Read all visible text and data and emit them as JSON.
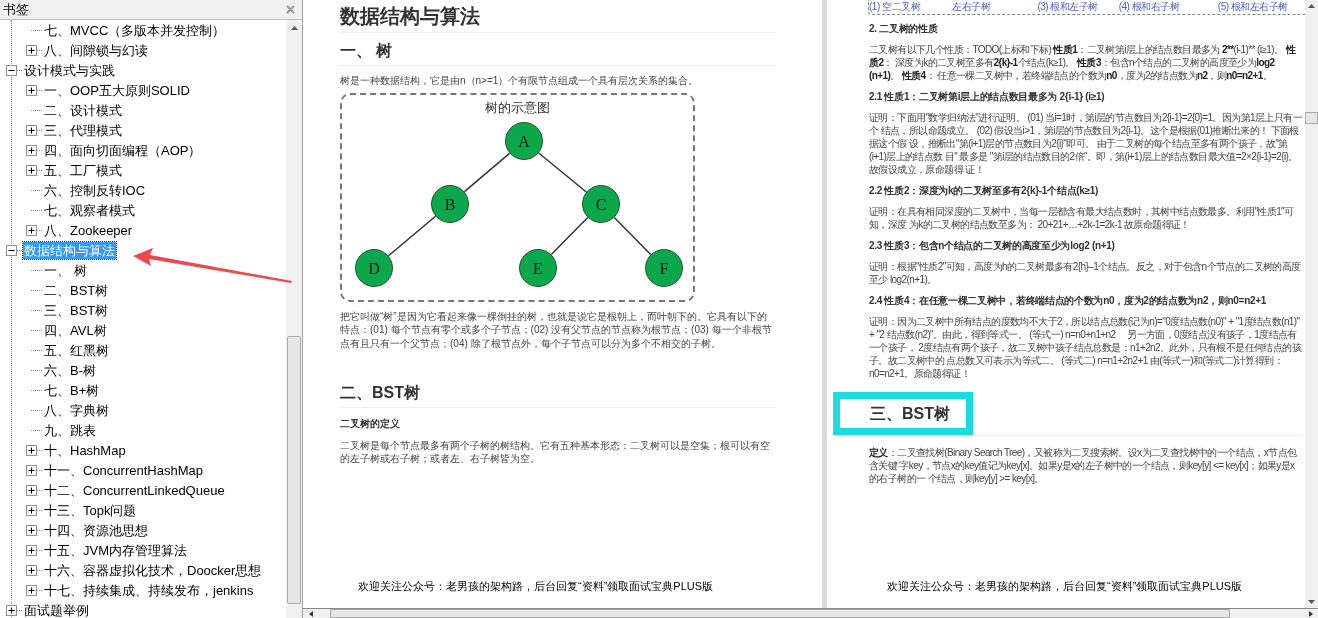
{
  "bookmarks_panel": {
    "title": "书签",
    "items": [
      {
        "kind": "continuation",
        "children": [
          {
            "kind": "leaf",
            "label": "七、MVCC（多版本并发控制）",
            "selected": false
          },
          {
            "kind": "branch",
            "label": "八、间隙锁与幻读",
            "expanded": false,
            "selected": false
          }
        ]
      },
      {
        "kind": "branch",
        "label": "设计模式与实践",
        "expanded": true,
        "selected": false,
        "children": [
          {
            "kind": "branch",
            "label": "一、OOP五大原则SOLID",
            "expanded": false,
            "selected": false
          },
          {
            "kind": "leaf",
            "label": "二、设计模式",
            "selected": false
          },
          {
            "kind": "branch",
            "label": "三、代理模式",
            "expanded": false,
            "selected": false
          },
          {
            "kind": "branch",
            "label": "四、面向切面编程（AOP）",
            "expanded": false,
            "selected": false
          },
          {
            "kind": "branch",
            "label": "五、工厂模式",
            "expanded": false,
            "selected": false
          },
          {
            "kind": "leaf",
            "label": "六、控制反转IOC",
            "selected": false
          },
          {
            "kind": "leaf",
            "label": "七、观察者模式",
            "selected": false
          },
          {
            "kind": "branch",
            "label": "八、Zookeeper",
            "expanded": false,
            "selected": false
          }
        ]
      },
      {
        "kind": "branch",
        "label": "数据结构与算法",
        "expanded": true,
        "selected": true,
        "children": [
          {
            "kind": "leaf",
            "label": "一、 树",
            "selected": false
          },
          {
            "kind": "leaf",
            "label": "二、BST树",
            "selected": false
          },
          {
            "kind": "leaf",
            "label": "三、BST树",
            "selected": false
          },
          {
            "kind": "leaf",
            "label": "四、AVL树",
            "selected": false
          },
          {
            "kind": "leaf",
            "label": "五、红黑树",
            "selected": false
          },
          {
            "kind": "leaf",
            "label": "六、B-树",
            "selected": false
          },
          {
            "kind": "leaf",
            "label": "七、B+树",
            "selected": false
          },
          {
            "kind": "leaf",
            "label": "八、字典树",
            "selected": false
          },
          {
            "kind": "leaf",
            "label": "九、跳表",
            "selected": false
          },
          {
            "kind": "branch",
            "label": "十、HashMap",
            "expanded": false,
            "selected": false
          },
          {
            "kind": "branch",
            "label": "十一、ConcurrentHashMap",
            "expanded": false,
            "selected": false
          },
          {
            "kind": "branch",
            "label": "十二、ConcurrentLinkedQueue",
            "expanded": false,
            "selected": false
          },
          {
            "kind": "branch",
            "label": "十三、Topk问题",
            "expanded": false,
            "selected": false
          },
          {
            "kind": "branch",
            "label": "十四、资源池思想",
            "expanded": false,
            "selected": false
          },
          {
            "kind": "branch",
            "label": "十五、JVM内存管理算法",
            "expanded": false,
            "selected": false
          },
          {
            "kind": "branch",
            "label": "十六、容器虚拟化技术，Doocker思想",
            "expanded": false,
            "selected": false
          },
          {
            "kind": "branch",
            "label": "十七、持续集成、持续发布，jenkins",
            "expanded": false,
            "selected": false
          }
        ]
      },
      {
        "kind": "branch",
        "label": "面试题举例",
        "expanded": false,
        "selected": false
      }
    ]
  },
  "page_1": {
    "title": "数据结构与算法",
    "section_1": {
      "heading": "一、 树",
      "intro": "树是一种数据结构，它是由n（n>=1）个有限节点组成一个具有层次关系的集合。",
      "figure": {
        "title": "树的示意图",
        "root": {
          "label": "A",
          "children": [
            {
              "label": "B",
              "children": [
                {
                  "label": "D"
                }
              ]
            },
            {
              "label": "C",
              "children": [
                {
                  "label": "E"
                },
                {
                  "label": "F"
                }
              ]
            }
          ]
        }
      },
      "body": "把它叫做“树”是因为它看起来像一棵倒挂的树，也就是说它是根朝上，而叶朝下的。它具有以下的特点：(01) 每个节点有零个或多个子节点；(02) 没有父节点的节点称为根节点；(03) 每一个非根节点有且只有一个父节点；(04) 除了根节点外，每个子节点可以分为多个不相交的子树。"
    },
    "section_2": {
      "heading": "二、BST树",
      "subheading": "二叉树的定义",
      "body": "二叉树是每个节点最多有两个子树的树结构。它有五种基本形态：二叉树可以是空集；根可以有空的左子树或右子树；或者左、右子树皆为空。"
    },
    "footer": "欢迎关注公众号：老男孩的架构路，后台回复“资料”领取面试宝典PLUS版"
  },
  "page_2": {
    "figure_captions": [
      "(1) 空二叉树",
      "左右子树",
      "(3) 根和左子树",
      "(4) 根和右子树",
      "(5) 根和左右子树"
    ],
    "blocks": [
      {
        "kind": "heading",
        "text": "2. 二叉树的性质"
      },
      {
        "kind": "paragraph",
        "lines": [
          [
            {
              "text": "二叉树有以下几个性质：TODO(上标和下标) ",
              "bold": false
            },
            {
              "text": "性质1",
              "bold": true
            },
            {
              "text": "：二叉树第i层上的结点数目最多为 ",
              "bold": false
            },
            {
              "text": "2**",
              "bold": true
            },
            {
              "text": "(i-1)** (i≥1)。 ",
              "bold": false
            },
            {
              "text": "性质2",
              "bold": true
            },
            {
              "text": "：",
              "bold": false
            }
          ],
          [
            {
              "text": "深度为k的二叉树至多有",
              "bold": false
            },
            {
              "text": "2{k}-1",
              "bold": true
            },
            {
              "text": "个结点(k≥1)。 ",
              "bold": false
            },
            {
              "text": "性质3",
              "bold": true
            },
            {
              "text": "：包含n个结点的二叉树的高度至少为",
              "bold": false
            },
            {
              "text": "log2 (n+1)",
              "bold": true
            },
            {
              "text": "。 ",
              "bold": false
            },
            {
              "text": "性质4",
              "bold": true
            },
            {
              "text": "：",
              "bold": false
            }
          ],
          [
            {
              "text": "任意一棵二叉树中，若终端结点的个数为",
              "bold": false
            },
            {
              "text": "n0",
              "bold": true
            },
            {
              "text": "，度为2的结点数为",
              "bold": false
            },
            {
              "text": "n2",
              "bold": true
            },
            {
              "text": "，则",
              "bold": false
            },
            {
              "text": "n0=n2+1",
              "bold": true
            },
            {
              "text": "。",
              "bold": false
            }
          ]
        ]
      },
      {
        "kind": "heading",
        "text": "2.1 性质1：二叉树第i层上的结点数目最多为 2{i-1} (i≥1)"
      },
      {
        "kind": "paragraph",
        "lines": [
          [
            {
              "text": "证明：下面用\"数学归纳法\"进行证明。 (01) 当i=1时，第i层的节点数目为2{i-1}=2{0}=1。因为第1层上只有一个",
              "bold": false
            }
          ],
          [
            {
              "text": "结点，所以命题成立。 (02) 假设当i>1，第i层的节点数目为2{i-1}。这个是根据(01)推断出来的！ 下面根据这个假",
              "bold": false
            }
          ],
          [
            {
              "text": "设，推断出\"第(i+1)层的节点数目为2{i}\"即可。 由于二叉树的每个结点至多有两个孩子，故\"第(i+1)层上的结点数",
              "bold": false
            }
          ],
          [
            {
              "text": "目\" 最多是 \"第i层的结点数目的2倍\"。即，第(i+1)层上的结点数目最大值=2×2{i-1}=2{i}。故假设成立，原命题得",
              "bold": false
            }
          ],
          [
            {
              "text": "证！",
              "bold": false
            }
          ]
        ]
      },
      {
        "kind": "heading",
        "text": "2.2 性质2：深度为k的二叉树至多有2{k}-1个结点(k≥1)"
      },
      {
        "kind": "paragraph",
        "lines": [
          [
            {
              "text": "证明：在具有相同深度的二叉树中，当每一层都含有最大结点数时，其树中结点数最多。利用\"性质1\"可知，深度",
              "bold": false
            }
          ],
          [
            {
              "text": "为k的二叉树的结点数至多为： 20+21+…+2k-1=2k-1 故原命题得证！",
              "bold": false
            }
          ]
        ]
      },
      {
        "kind": "heading",
        "text": "2.3 性质3：包含n个结点的二叉树的高度至少为log2 (n+1)"
      },
      {
        "kind": "paragraph",
        "lines": [
          [
            {
              "text": "证明：根据\"性质2\"可知，高度为h的二叉树最多有2{h}–1个结点。反之，对于包含n个节点的二叉树的高度至少",
              "bold": false
            }
          ],
          [
            {
              "text": "log2(n+1)。",
              "bold": false
            }
          ]
        ]
      },
      {
        "kind": "heading",
        "text": "2.4 性质4：在任意一棵二叉树中，若终端结点的个数为n0，度为2的结点数为n2，则n0=n2+1"
      },
      {
        "kind": "paragraph",
        "lines": [
          [
            {
              "text": "证明：因为二叉树中所有结点的度数均不大于2，所以结点总数(记为n)=\"0度结点数(n0)\" + \"1度结点数(n1)\" + \"2",
              "bold": false
            }
          ],
          [
            {
              "text": "结点数(n2)\"。由此，得到等式一。 (等式一) n=n0+n1+n2　 另一方面，0度结点没有孩子，1度结点有一个孩子，",
              "bold": false
            }
          ],
          [
            {
              "text": "2度结点有两个孩子，故二叉树中孩子结点总数是：n1+2n2。此外，只有根不是任何结点的孩子。故二叉树中的",
              "bold": false
            }
          ],
          [
            {
              "text": "点总数又可表示为等式二。 (等式二) n=n1+2n2+1 由(等式一)和(等式二)计算得到：n0=n2+1。原命题得证！",
              "bold": false
            }
          ]
        ]
      },
      {
        "kind": "section",
        "text": "三、BST树",
        "highlighted": true
      },
      {
        "kind": "paragraph",
        "lines": [
          [
            {
              "text": "定义",
              "bold": true
            },
            {
              "text": "：二叉查找树(Binary Search Tree)，又被称为二叉搜索树。设x为二叉查找树中的一个结点，x节点包含关键",
              "bold": false
            }
          ],
          [
            {
              "text": "字key，节点x的key值记为key[x]。如果y是x的左子树中的一个结点，则key[y] <= key[x]；如果y是x的右子树的一",
              "bold": false
            }
          ],
          [
            {
              "text": "个结点，则key[y] >= key[x]。",
              "bold": false
            }
          ]
        ]
      }
    ],
    "footer": "欢迎关注公众号：老男孩的架构路，后台回复“资料”领取面试宝典PLUS版"
  }
}
